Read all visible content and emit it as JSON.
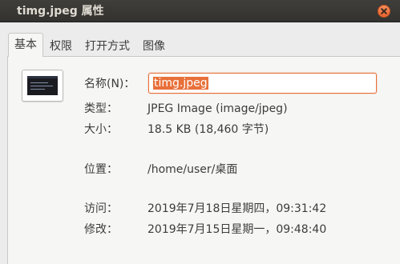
{
  "window": {
    "title": "timg.jpeg 属性"
  },
  "tabs": [
    {
      "label": "基本",
      "active": true
    },
    {
      "label": "权限",
      "active": false
    },
    {
      "label": "打开方式",
      "active": false
    },
    {
      "label": "图像",
      "active": false
    }
  ],
  "basic": {
    "name_label": "名称(N)：",
    "name_value": "timg.jpeg",
    "type_label": "类型：",
    "type_value": "JPEG Image (image/jpeg)",
    "size_label": "大小：",
    "size_value": "18.5 KB (18,460 字节)",
    "location_label": "位置：",
    "location_value": "/home/user/桌面",
    "accessed_label": "访问：",
    "accessed_value": "2019年7月18日星期四，09:31:42",
    "modified_label": "修改：",
    "modified_value": "2019年7月15日星期一，09:48:40"
  },
  "icons": {
    "close": "close-icon",
    "thumbnail": "image-thumbnail"
  },
  "colors": {
    "titlebar": "#3a3935",
    "accent": "#e8703a",
    "close_button": "#ee7343"
  }
}
